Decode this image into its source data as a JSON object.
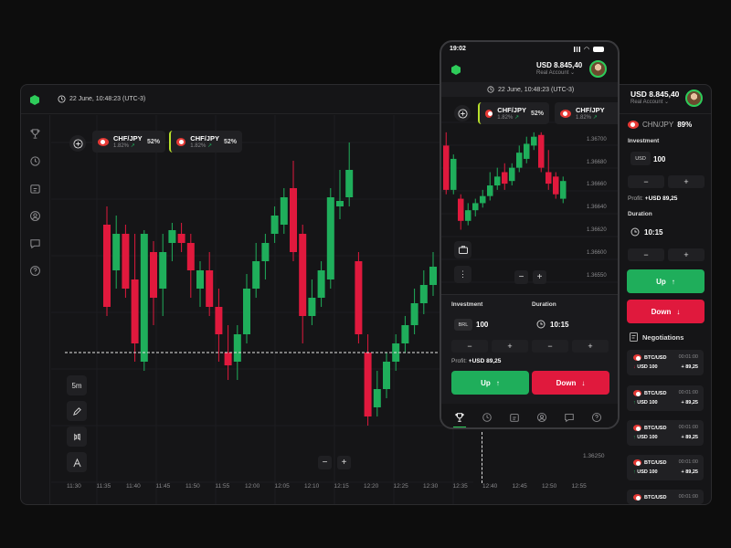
{
  "desktop": {
    "datetime": "22 June, 10:48:23 (UTC-3)",
    "pairs": [
      {
        "name": "CHF/JPY",
        "change": "1.82%",
        "percent": "52%"
      },
      {
        "name": "CHF/JPY",
        "change": "1.82%",
        "percent": "52%"
      }
    ],
    "sidebar_icons": [
      "trophy-icon",
      "history-icon",
      "portfolio-icon",
      "account-icon",
      "chat-icon",
      "help-icon"
    ],
    "tools": {
      "timeframe": "5m"
    },
    "zoom": {
      "minus": "−",
      "plus": "+"
    },
    "price_label": "1.36250",
    "x_ticks": [
      "11:30",
      "11:35",
      "11:40",
      "11:45",
      "11:50",
      "11:55",
      "12:00",
      "12:05",
      "12:10",
      "12:15",
      "12:20",
      "12:25",
      "12:30",
      "12:35",
      "12:40",
      "12:45",
      "12:50",
      "12:55"
    ]
  },
  "right_panel": {
    "balance": "USD 8.845,40",
    "account": "Real Account",
    "pair": "CHN/JPY",
    "pair_percent": "89%",
    "investment_label": "Investment",
    "currency": "USD",
    "investment_value": "100",
    "profit_label": "Profit:",
    "profit_value": "+USD 89,25",
    "duration_label": "Duration",
    "duration_value": "10:15",
    "up_label": "Up",
    "down_label": "Down",
    "negotiations_label": "Negotiations",
    "negotiations": [
      {
        "asset": "BTC/USD",
        "time": "00:01:00",
        "amount": "USD 100",
        "profit": "+ 89,25",
        "dir": "down"
      },
      {
        "asset": "BTC/USD",
        "time": "00:01:00",
        "amount": "USD 100",
        "profit": "+ 89,25",
        "dir": "up"
      },
      {
        "asset": "BTC/USD",
        "time": "00:01:00",
        "amount": "USD 100",
        "profit": "+ 89,25",
        "dir": "up"
      },
      {
        "asset": "BTC/USD",
        "time": "00:01:00",
        "amount": "USD 100",
        "profit": "+ 89,25",
        "dir": "up"
      },
      {
        "asset": "BTC/USD",
        "time": "00:01:00",
        "amount": "USD 100",
        "profit": "",
        "dir": "up"
      }
    ]
  },
  "phone": {
    "time": "19:02",
    "balance": "USD 8.845,40",
    "account": "Real Account",
    "datetime": "22 June, 10:48:23 (UTC-3)",
    "pairs": [
      {
        "name": "CHF/JPY",
        "change": "1.82%",
        "percent": "52%"
      },
      {
        "name": "CHF/JPY",
        "change": "1.82%",
        "percent": ""
      }
    ],
    "price_ticks": [
      "1.36700",
      "1.36680",
      "1.36660",
      "1.36640",
      "1.36620",
      "1.36600",
      "1.36550"
    ],
    "investment_label": "Investment",
    "duration_label": "Duration",
    "currency": "BRL",
    "investment_value": "100",
    "duration_value": "10:15",
    "profit_label": "Profit:",
    "profit_value": "+USD 89,25",
    "up_label": "Up",
    "down_label": "Down",
    "tab_icons": [
      "trophy-icon",
      "history-icon",
      "portfolio-icon",
      "account-icon",
      "chat-icon",
      "help-icon"
    ]
  },
  "colors": {
    "up": "#1fae5b",
    "down": "#e0193d",
    "accent": "#2ecc5a",
    "background": "#151517"
  },
  "chart_data": {
    "type": "candlestick",
    "candles_desktop": [
      {
        "o": 1.36395,
        "c": 1.3635,
        "h": 1.36405,
        "l": 1.36345
      },
      {
        "o": 1.3637,
        "c": 1.3639,
        "h": 1.364,
        "l": 1.3636
      },
      {
        "o": 1.3639,
        "c": 1.3636,
        "h": 1.36395,
        "l": 1.36355
      },
      {
        "o": 1.36365,
        "c": 1.3633,
        "h": 1.3639,
        "l": 1.3632
      },
      {
        "o": 1.3632,
        "c": 1.3639,
        "h": 1.36392,
        "l": 1.36315
      },
      {
        "o": 1.3638,
        "c": 1.36355,
        "h": 1.36386,
        "l": 1.3634
      },
      {
        "o": 1.3636,
        "c": 1.3638,
        "h": 1.3639,
        "l": 1.36345
      },
      {
        "o": 1.36385,
        "c": 1.36392,
        "h": 1.36396,
        "l": 1.36375
      },
      {
        "o": 1.3639,
        "c": 1.36385,
        "h": 1.36396,
        "l": 1.3638
      },
      {
        "o": 1.36385,
        "c": 1.3637,
        "h": 1.3639,
        "l": 1.36355
      },
      {
        "o": 1.3636,
        "c": 1.3637,
        "h": 1.36375,
        "l": 1.3635
      },
      {
        "o": 1.3637,
        "c": 1.3635,
        "h": 1.3638,
        "l": 1.36345
      },
      {
        "o": 1.3635,
        "c": 1.36335,
        "h": 1.3636,
        "l": 1.3632
      },
      {
        "o": 1.36325,
        "c": 1.36318,
        "h": 1.3634,
        "l": 1.3631
      },
      {
        "o": 1.3632,
        "c": 1.36335,
        "h": 1.3634,
        "l": 1.3631
      },
      {
        "o": 1.36335,
        "c": 1.3636,
        "h": 1.36368,
        "l": 1.3633
      },
      {
        "o": 1.3636,
        "c": 1.36375,
        "h": 1.36385,
        "l": 1.36355
      },
      {
        "o": 1.36375,
        "c": 1.36385,
        "h": 1.3639,
        "l": 1.36365
      },
      {
        "o": 1.3639,
        "c": 1.364,
        "h": 1.36405,
        "l": 1.36385
      },
      {
        "o": 1.36395,
        "c": 1.3641,
        "h": 1.36415,
        "l": 1.3639
      },
      {
        "o": 1.36415,
        "c": 1.3638,
        "h": 1.3643,
        "l": 1.36375
      },
      {
        "o": 1.3639,
        "c": 1.36345,
        "h": 1.36395,
        "l": 1.3633
      },
      {
        "o": 1.36345,
        "c": 1.36355,
        "h": 1.36365,
        "l": 1.3634
      },
      {
        "o": 1.36355,
        "c": 1.3637,
        "h": 1.36375,
        "l": 1.3635
      },
      {
        "o": 1.36365,
        "c": 1.3641,
        "h": 1.36415,
        "l": 1.3636
      },
      {
        "o": 1.36405,
        "c": 1.36408,
        "h": 1.36425,
        "l": 1.36398
      },
      {
        "o": 1.3641,
        "c": 1.36425,
        "h": 1.3644,
        "l": 1.36405
      },
      {
        "o": 1.36375,
        "c": 1.36335,
        "h": 1.3638,
        "l": 1.3633
      },
      {
        "o": 1.36325,
        "c": 1.3629,
        "h": 1.36335,
        "l": 1.36285
      },
      {
        "o": 1.36295,
        "c": 1.36305,
        "h": 1.36315,
        "l": 1.3629
      },
      {
        "o": 1.36305,
        "c": 1.3632,
        "h": 1.36325,
        "l": 1.363
      },
      {
        "o": 1.3632,
        "c": 1.3633,
        "h": 1.36335,
        "l": 1.36315
      },
      {
        "o": 1.3633,
        "c": 1.3634,
        "h": 1.36345,
        "l": 1.36325
      },
      {
        "o": 1.3634,
        "c": 1.36352,
        "h": 1.3636,
        "l": 1.36335
      },
      {
        "o": 1.36352,
        "c": 1.36362,
        "h": 1.3637,
        "l": 1.36346
      },
      {
        "o": 1.36362,
        "c": 1.36372,
        "h": 1.3638,
        "l": 1.36356
      }
    ],
    "desktop_ylim": [
      1.36245,
      1.36445
    ],
    "current_price_desktop": 1.36325,
    "candles_phone": [
      {
        "o": 1.3669,
        "c": 1.3664,
        "h": 1.36705,
        "l": 1.36635
      },
      {
        "o": 1.3664,
        "c": 1.36675,
        "h": 1.3668,
        "l": 1.36635
      },
      {
        "o": 1.3663,
        "c": 1.36605,
        "h": 1.36635,
        "l": 1.36595
      },
      {
        "o": 1.36605,
        "c": 1.36617,
        "h": 1.36625,
        "l": 1.366
      },
      {
        "o": 1.36617,
        "c": 1.36625,
        "h": 1.3663,
        "l": 1.3661
      },
      {
        "o": 1.36625,
        "c": 1.36633,
        "h": 1.3664,
        "l": 1.3662
      },
      {
        "o": 1.36633,
        "c": 1.36645,
        "h": 1.3666,
        "l": 1.36628
      },
      {
        "o": 1.36645,
        "c": 1.36655,
        "h": 1.36665,
        "l": 1.3664
      },
      {
        "o": 1.3666,
        "c": 1.36647,
        "h": 1.3667,
        "l": 1.3664
      },
      {
        "o": 1.3665,
        "c": 1.36665,
        "h": 1.3667,
        "l": 1.36645
      },
      {
        "o": 1.36665,
        "c": 1.36682,
        "h": 1.3669,
        "l": 1.3666
      },
      {
        "o": 1.36675,
        "c": 1.36692,
        "h": 1.367,
        "l": 1.3667
      },
      {
        "o": 1.3669,
        "c": 1.367,
        "h": 1.36705,
        "l": 1.36685
      },
      {
        "o": 1.36702,
        "c": 1.36665,
        "h": 1.36705,
        "l": 1.3666
      },
      {
        "o": 1.3666,
        "c": 1.36647,
        "h": 1.36685,
        "l": 1.3664
      },
      {
        "o": 1.36655,
        "c": 1.36635,
        "h": 1.3666,
        "l": 1.3663
      },
      {
        "o": 1.3663,
        "c": 1.3665,
        "h": 1.36655,
        "l": 1.36625
      }
    ],
    "phone_ylim": [
      1.36545,
      1.3671
    ]
  }
}
